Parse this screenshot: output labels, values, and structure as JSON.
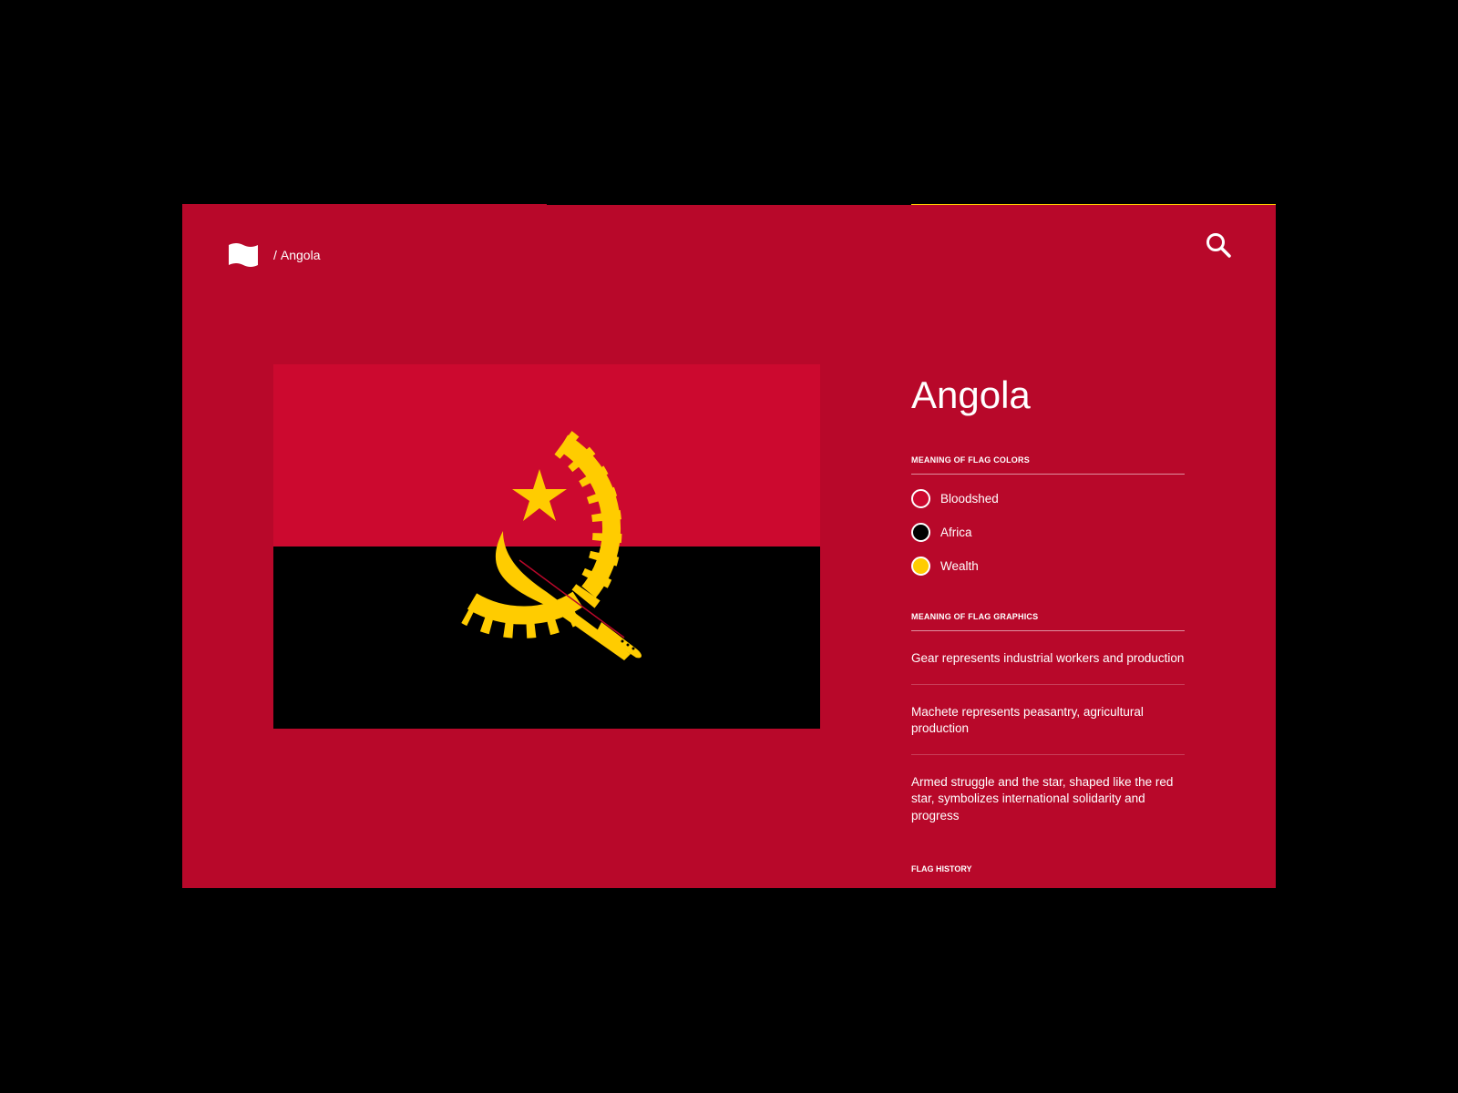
{
  "header": {
    "separator": "/",
    "breadcrumb": "Angola"
  },
  "country": {
    "name": "Angola"
  },
  "colors": {
    "label": "MEANING OF FLAG COLORS",
    "items": [
      {
        "label": "Bloodshed",
        "hex": "#CC092F"
      },
      {
        "label": "Africa",
        "hex": "#000000"
      },
      {
        "label": "Wealth",
        "hex": "#FFCC00"
      }
    ]
  },
  "graphics": {
    "label": "MEANING OF FLAG GRAPHICS",
    "items": [
      "Gear represents industrial workers and production",
      "Machete represents peasantry, agricultural production",
      "Armed struggle and the star, shaped like the red star, symbolizes international solidarity and progress"
    ]
  },
  "history": {
    "label": "FLAG HISTORY"
  },
  "theme": {
    "background": "#B8082A",
    "flag_red": "#CC092F",
    "flag_black": "#000000",
    "flag_yellow": "#FFCC00"
  },
  "icons": {
    "logo": "flag-icon",
    "search": "search-icon"
  }
}
